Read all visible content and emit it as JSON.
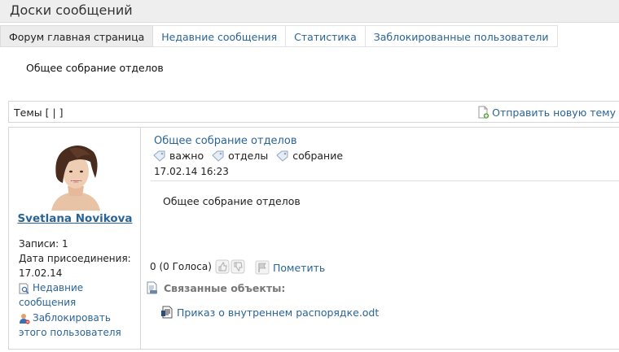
{
  "header": {
    "title": "Доски сообщений"
  },
  "tabs": [
    {
      "label": "Форум главная страница"
    },
    {
      "label": "Недавние сообщения"
    },
    {
      "label": "Статистика"
    },
    {
      "label": "Заблокированные пользователи"
    }
  ],
  "thread": {
    "heading": "Общее собрание отделов"
  },
  "topics_bar": {
    "label": "Темы [ | ]",
    "new_topic": "Отправить новую тему"
  },
  "post": {
    "author": {
      "name": "Svetlana Novikova",
      "posts": "Записи: 1",
      "joined_label": "Дата присоединения:",
      "joined_date": "17.02.14",
      "recent_posts": [
        "Недавние",
        "сообщения"
      ],
      "block_user": [
        "Заблокировать",
        "этого пользователя"
      ]
    },
    "title": "Общее собрание отделов",
    "tags": [
      "важно",
      "отделы",
      "собрание"
    ],
    "date": "17.02.14 16:23",
    "body": "Общее собрание отделов",
    "votes": "0 (0 Голоса)",
    "flag": "Пометить",
    "related_label": "Связанные объекты:",
    "related_items": [
      "Приказ о внутреннем распорядке.odt"
    ]
  },
  "colors": {
    "link": "#2a6496",
    "header_bg": "#eeeeee",
    "border": "#d6d6d6"
  }
}
